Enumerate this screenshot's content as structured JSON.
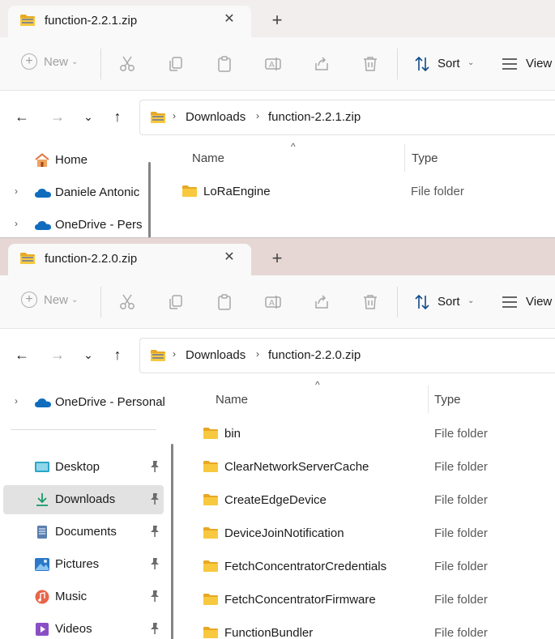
{
  "windows": [
    {
      "tab": {
        "title": "function-2.2.1.zip",
        "close_glyph": "✕",
        "new_tab_glyph": "+"
      },
      "toolbar": {
        "new_label": "New",
        "sort_label": "Sort",
        "view_label": "View"
      },
      "address": {
        "crumb1": "Downloads",
        "crumb2": "function-2.2.1.zip"
      },
      "sidebar": [
        {
          "label": "Home",
          "icon": "home-icon"
        },
        {
          "label": "Daniele Antonic",
          "icon": "cloud-icon"
        },
        {
          "label": "OneDrive - Perso",
          "icon": "cloud-icon"
        }
      ],
      "columns": {
        "name": "Name",
        "type": "Type"
      },
      "rows": [
        {
          "name": "LoRaEngine",
          "type": "File folder"
        }
      ]
    },
    {
      "tab": {
        "title": "function-2.2.0.zip",
        "close_glyph": "✕",
        "new_tab_glyph": "+"
      },
      "toolbar": {
        "new_label": "New",
        "sort_label": "Sort",
        "view_label": "View"
      },
      "address": {
        "crumb1": "Downloads",
        "crumb2": "function-2.2.0.zip"
      },
      "sidebar": [
        {
          "label": "OneDrive - Personal",
          "icon": "cloud-icon"
        },
        {
          "label": "Desktop",
          "icon": "desktop-icon"
        },
        {
          "label": "Downloads",
          "icon": "download-icon",
          "selected": true
        },
        {
          "label": "Documents",
          "icon": "document-icon"
        },
        {
          "label": "Pictures",
          "icon": "pictures-icon"
        },
        {
          "label": "Music",
          "icon": "music-icon"
        },
        {
          "label": "Videos",
          "icon": "videos-icon"
        }
      ],
      "columns": {
        "name": "Name",
        "type": "Type"
      },
      "rows": [
        {
          "name": "bin",
          "type": "File folder"
        },
        {
          "name": "ClearNetworkServerCache",
          "type": "File folder"
        },
        {
          "name": "CreateEdgeDevice",
          "type": "File folder"
        },
        {
          "name": "DeviceJoinNotification",
          "type": "File folder"
        },
        {
          "name": "FetchConcentratorCredentials",
          "type": "File folder"
        },
        {
          "name": "FetchConcentratorFirmware",
          "type": "File folder"
        },
        {
          "name": "FunctionBundler",
          "type": "File folder"
        }
      ]
    }
  ],
  "glyphs": {
    "chevron_right": "›",
    "chevron_down": "⌄",
    "back": "←",
    "forward": "→",
    "up": "↑",
    "sort_caret": "^"
  },
  "colors": {
    "folder": "#f8c93e",
    "folder_dark": "#e8a823",
    "onedrive": "#0f6cbd",
    "accent": "#0078d4"
  }
}
